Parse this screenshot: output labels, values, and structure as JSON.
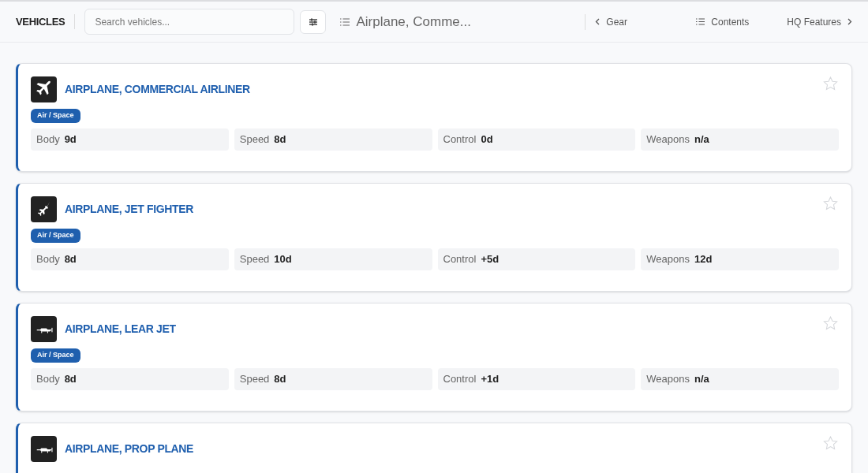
{
  "header": {
    "title": "VEHICLES",
    "search": {
      "placeholder": "Search vehicles..."
    },
    "current": "Airplane, Comme...",
    "prev": "Gear",
    "contents": "Contents",
    "next": "HQ Features"
  },
  "vehicles": [
    {
      "kind": "airliner",
      "name": "AIRPLANE, COMMERCIAL AIRLINER",
      "tag": "Air / Space",
      "favorite": false,
      "stats": [
        {
          "label": "Body",
          "value": "9d"
        },
        {
          "label": "Speed",
          "value": "8d"
        },
        {
          "label": "Control",
          "value": "0d"
        },
        {
          "label": "Weapons",
          "value": "n/a"
        }
      ]
    },
    {
      "kind": "fighter",
      "name": "AIRPLANE, JET FIGHTER",
      "tag": "Air / Space",
      "favorite": false,
      "stats": [
        {
          "label": "Body",
          "value": "8d"
        },
        {
          "label": "Speed",
          "value": "10d"
        },
        {
          "label": "Control",
          "value": "+5d"
        },
        {
          "label": "Weapons",
          "value": "12d"
        }
      ]
    },
    {
      "kind": "small",
      "name": "AIRPLANE, LEAR JET",
      "tag": "Air / Space",
      "favorite": false,
      "stats": [
        {
          "label": "Body",
          "value": "8d"
        },
        {
          "label": "Speed",
          "value": "8d"
        },
        {
          "label": "Control",
          "value": "+1d"
        },
        {
          "label": "Weapons",
          "value": "n/a"
        }
      ]
    },
    {
      "kind": "small",
      "name": "AIRPLANE, PROP PLANE",
      "favorite": false
    }
  ]
}
